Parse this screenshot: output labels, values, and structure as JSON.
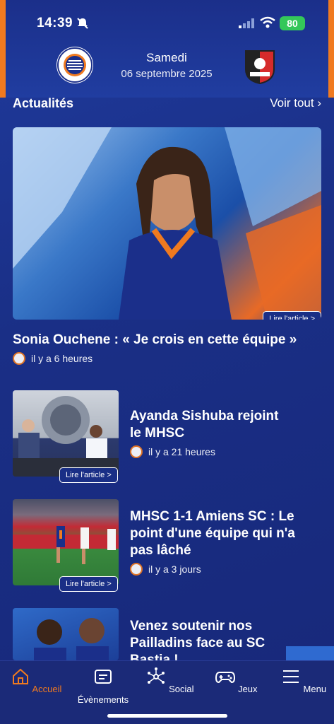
{
  "status": {
    "time": "14:39",
    "battery": "80"
  },
  "match": {
    "day": "Samedi",
    "date": "06 septembre 2025"
  },
  "news": {
    "title": "Actualités",
    "see_all": "Voir tout",
    "read_label": "Lire l'article >",
    "hero": {
      "title": "Sonia Ouchene : « Je crois en cette équipe »",
      "time": "il y a 6 heures"
    },
    "items": [
      {
        "title_l1": "Ayanda Sishuba rejoint",
        "title_l2": "le MHSC",
        "time": "il y a 21 heures"
      },
      {
        "title_l1": "MHSC 1-1 Amiens SC : Le",
        "title_l2": "point d'une équipe qui n'a",
        "title_l3": "pas lâché",
        "time": "il y a 3 jours"
      },
      {
        "title_l1": "Venez soutenir nos",
        "title_l2": "Pailladins face au SC",
        "title_l3": "Bastia !"
      }
    ]
  },
  "nav": [
    {
      "label": "Accueil",
      "icon": "home-icon",
      "active": true
    },
    {
      "label": "Évènements",
      "icon": "events-icon"
    },
    {
      "label": "Social",
      "icon": "social-icon"
    },
    {
      "label": "Jeux",
      "icon": "gamepad-icon"
    },
    {
      "label": "Menu",
      "icon": "menu-icon"
    }
  ],
  "colors": {
    "accent": "#f07a1f",
    "background": "#1a2f86"
  }
}
